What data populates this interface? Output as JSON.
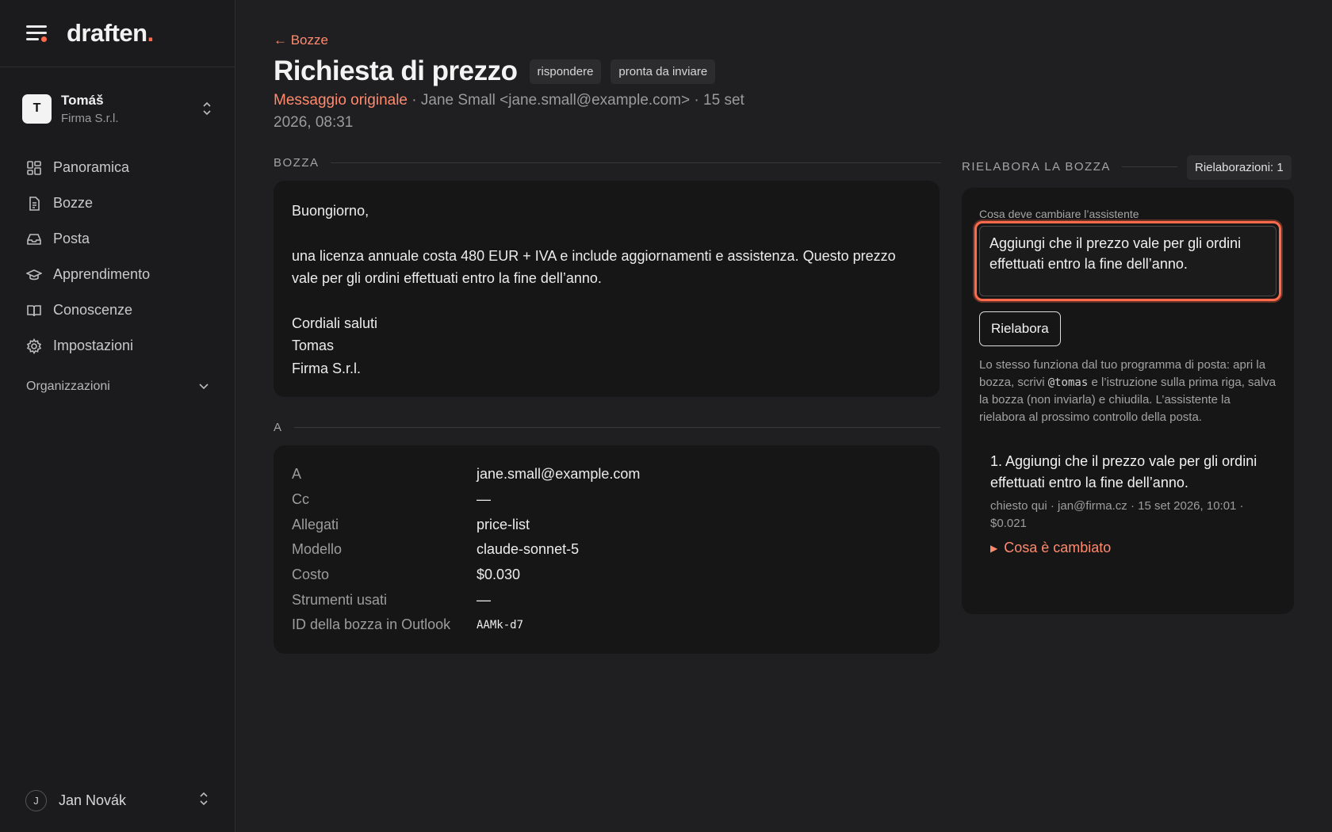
{
  "app": {
    "logo": "draften",
    "logo_dot": "."
  },
  "account": {
    "initial": "T",
    "name": "Tomáš",
    "org": "Firma S.r.l."
  },
  "nav": [
    {
      "label": "Panoramica",
      "icon": "grid-icon"
    },
    {
      "label": "Bozze",
      "icon": "document-icon"
    },
    {
      "label": "Posta",
      "icon": "inbox-icon"
    },
    {
      "label": "Apprendimento",
      "icon": "graduation-cap-icon"
    },
    {
      "label": "Conoscenze",
      "icon": "book-icon"
    },
    {
      "label": "Impostazioni",
      "icon": "gear-icon"
    }
  ],
  "organizations_label": "Organizzazioni",
  "user": {
    "initial": "J",
    "name": "Jan Novák"
  },
  "header": {
    "back_label": "← Bozze",
    "title": "Richiesta di prezzo",
    "badges": [
      "rispondere",
      "pronta da inviare"
    ],
    "original_link": "Messaggio originale",
    "meta_rest": " · Jane Small <jane.small@example.com> · 15 set 2026, 08:31"
  },
  "draft": {
    "section_label": "BOZZA",
    "greeting": "Buongiorno,",
    "body": "una licenza annuale costa 480 EUR + IVA e include aggiornamenti e assistenza. Questo prezzo vale per gli ordini effettuati entro la fine dell’anno.",
    "closing": "Cordiali saluti",
    "signature_name": "Tomas",
    "signature_org": "Firma S.r.l."
  },
  "details": {
    "section_label": "A",
    "rows": [
      {
        "key": "A",
        "value": "jane.small@example.com"
      },
      {
        "key": "Cc",
        "value": "—"
      },
      {
        "key": "Allegati",
        "value": "price-list"
      },
      {
        "key": "Modello",
        "value": "claude-sonnet-5"
      },
      {
        "key": "Costo",
        "value": "$0.030"
      },
      {
        "key": "Strumenti usati",
        "value": "—"
      },
      {
        "key": "ID della bozza in Outlook",
        "value": "AAMk-d7"
      }
    ]
  },
  "rework": {
    "section_label": "RIELABORA LA BOZZA",
    "count_label": "Rielaborazioni: 1",
    "field_label": "Cosa deve cambiare l’assistente",
    "field_value": "Aggiungi che il prezzo vale per gli ordini effettuati entro la fine dell’anno.",
    "button_label": "Rielabora",
    "help_before": "Lo stesso funziona dal tuo programma di posta: apri la bozza, scrivi ",
    "help_code": "@tomas",
    "help_after": " e l’istruzione sulla prima riga, salva la bozza (non inviarla) e chiudila. L’assistente la rielabora al prossimo controllo della posta.",
    "history": [
      {
        "title": "1. Aggiungi che il prezzo vale per gli ordini effettuati entro la fine dell’anno.",
        "meta": "chiesto qui · jan@firma.cz · 15 set 2026, 10:01 · $0.021",
        "changed_label": "Cosa è cambiato"
      }
    ]
  },
  "colors": {
    "accent": "#ff6b4a",
    "background": "#1f1f21",
    "sidebar": "#1b1b1d",
    "card": "#161617"
  }
}
